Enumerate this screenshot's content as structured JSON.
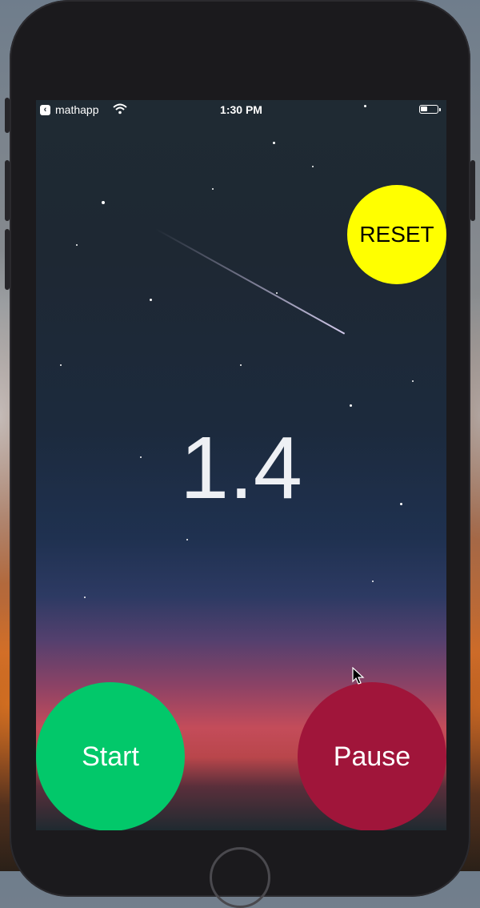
{
  "status_bar": {
    "app_name": "mathapp",
    "time": "1:30 PM",
    "icons": [
      "back-arrow-icon",
      "wifi-icon",
      "battery-icon"
    ]
  },
  "timer": {
    "value": "1.4"
  },
  "buttons": {
    "reset_label": "RESET",
    "start_label": "Start",
    "pause_label": "Pause"
  },
  "colors": {
    "reset": "#ffff00",
    "start": "#02c86a",
    "pause": "#a0153a",
    "counter_text": "#eef0f4"
  }
}
